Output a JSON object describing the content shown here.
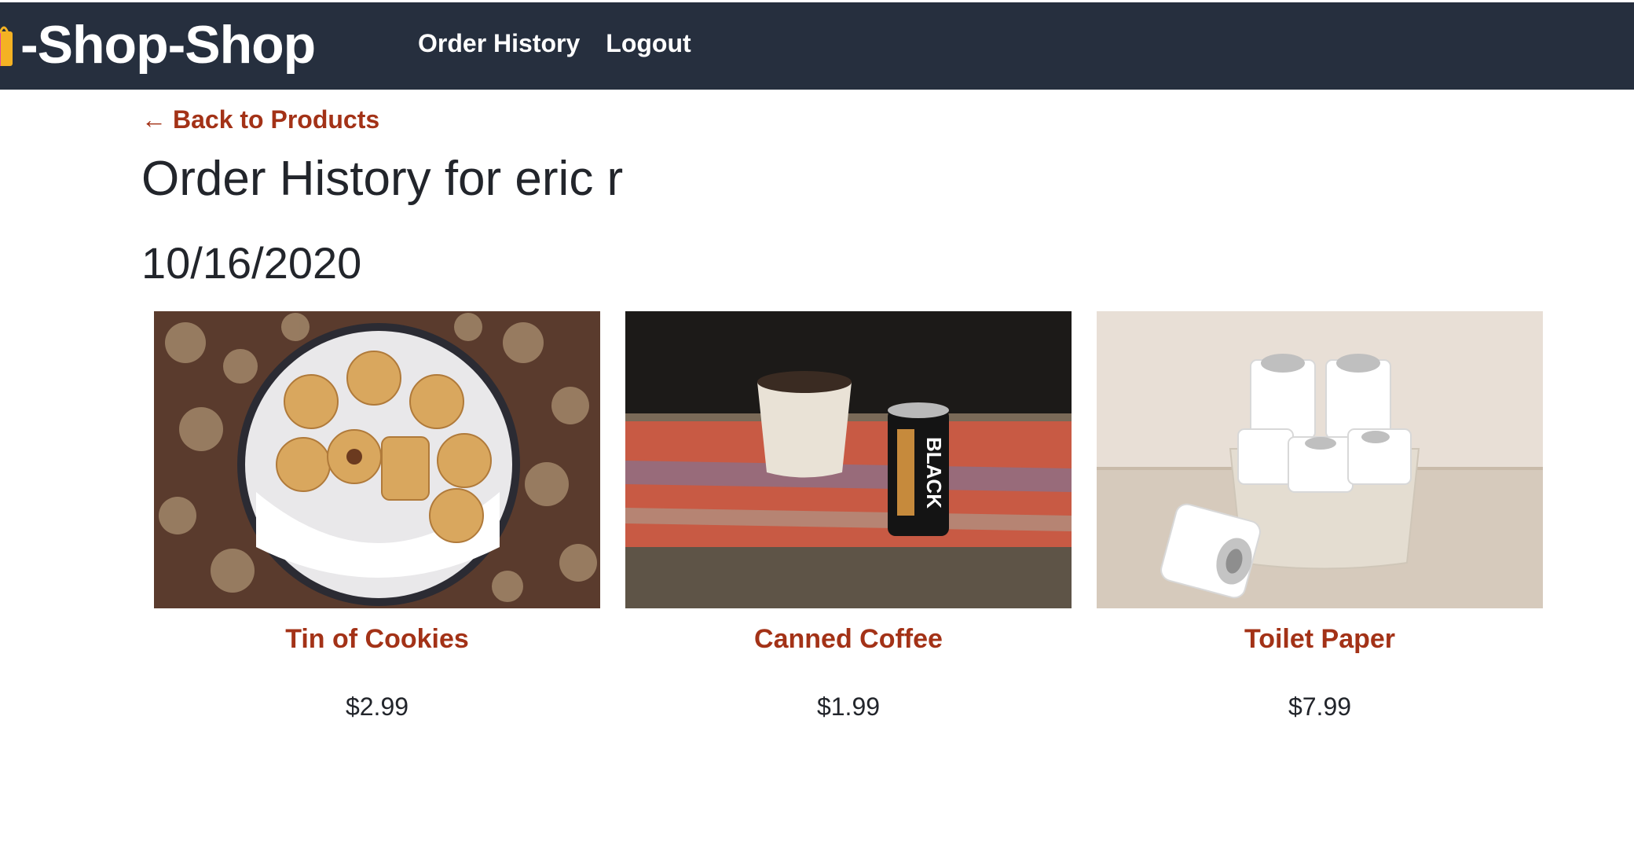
{
  "nav": {
    "brand": "-Shop-Shop",
    "brand_icon": "shopping-bag-icon",
    "links": [
      "Order History",
      "Logout"
    ]
  },
  "back_link": {
    "arrow": "←",
    "label": "Back to Products"
  },
  "page_title": "Order History for eric r",
  "order": {
    "date": "10/16/2020",
    "items": [
      {
        "name": "Tin of Cookies",
        "price": "$2.99",
        "image": "cookie-tin-photo"
      },
      {
        "name": "Canned Coffee",
        "price": "$1.99",
        "image": "canned-coffee-photo"
      },
      {
        "name": "Toilet Paper",
        "price": "$7.99",
        "image": "toilet-paper-photo"
      }
    ]
  },
  "colors": {
    "navbar": "#262f3e",
    "accent": "#a33217",
    "text": "#22252b"
  }
}
